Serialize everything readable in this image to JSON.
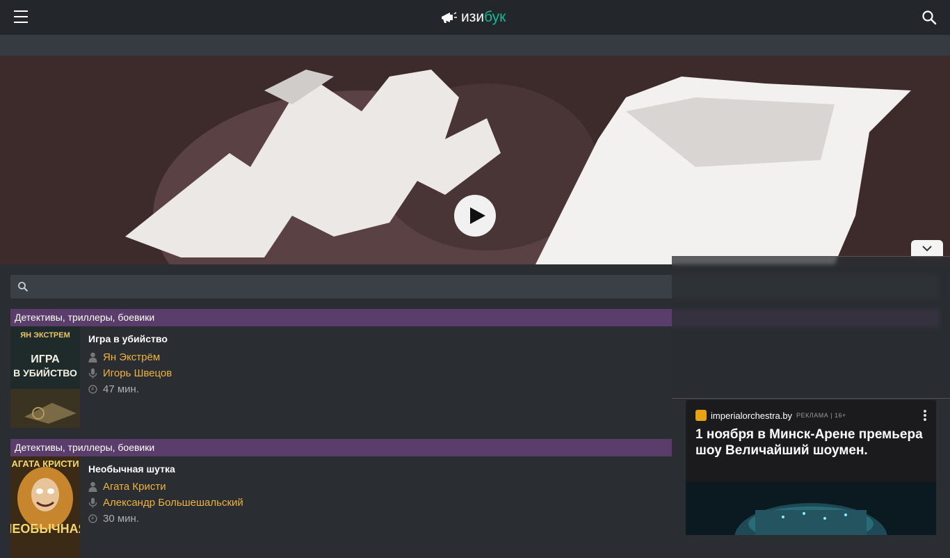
{
  "header": {
    "logo_part1": "изи",
    "logo_part2": "бук",
    "logo_icon": "megaphone-icon",
    "menu_icon": "hamburger-icon",
    "search_icon": "search-icon"
  },
  "player": {
    "play_icon": "play-icon"
  },
  "search": {
    "placeholder": "",
    "value": ""
  },
  "books": [
    {
      "genre": "Детективы, триллеры, боевики",
      "cover_text": "ЯН ЭКСТРЕМ / ИГРА В УБИЙСТВО",
      "title": "Игра в убийство",
      "author": "Ян Экстрём",
      "reader": "Игорь Швецов",
      "duration": "47 мин."
    },
    {
      "genre": "Детективы, триллеры, боевики",
      "cover_text": "АГАТА КРИСТИ / НЕОБЫЧНАЯ",
      "title": "Необычная шутка",
      "author": "Агата Кристи",
      "reader": "Александр Большешальский",
      "duration": "30 мин."
    }
  ],
  "ad": {
    "domain": "imperialorchestra.by",
    "label": "РЕКЛАМА | 16+",
    "title": "1 ноября в Минск-Арене премьера шоу Величайший шоумен.",
    "toggle_icon": "chevron-down-icon",
    "more_icon": "more-vertical-icon"
  }
}
